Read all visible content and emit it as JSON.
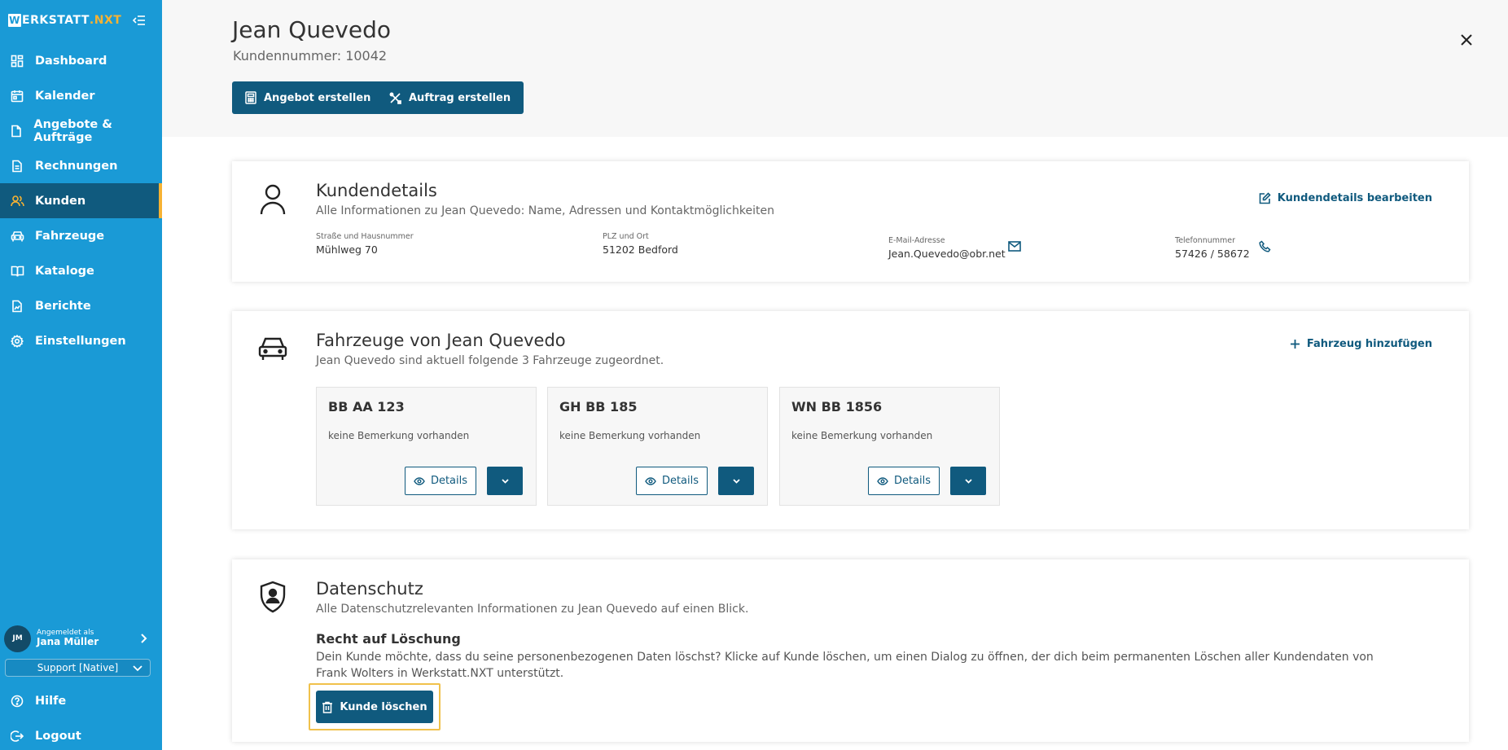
{
  "app": {
    "logo_w": "W",
    "logo_text": "ERKSTATT",
    "logo_suffix": ".NXT"
  },
  "sidebar": {
    "items": [
      {
        "label": "Dashboard",
        "icon": "dashboard-icon"
      },
      {
        "label": "Kalender",
        "icon": "calendar-icon"
      },
      {
        "label": "Angebote & Aufträge",
        "icon": "document-icon"
      },
      {
        "label": "Rechnungen",
        "icon": "invoice-icon"
      },
      {
        "label": "Kunden",
        "icon": "users-icon",
        "active": true
      },
      {
        "label": "Fahrzeuge",
        "icon": "car-icon"
      },
      {
        "label": "Kataloge",
        "icon": "book-icon"
      },
      {
        "label": "Berichte",
        "icon": "report-icon"
      },
      {
        "label": "Einstellungen",
        "icon": "gear-icon"
      }
    ],
    "user": {
      "initials": "JM",
      "logged_in_label": "Angemeldet als",
      "name": "Jana Müller"
    },
    "support_select": "Support [Native]",
    "help_label": "Hilfe",
    "logout_label": "Logout"
  },
  "header": {
    "customer_name": "Jean Quevedo",
    "customer_number": "Kundennummer: 10042",
    "btn_offer": "Angebot erstellen",
    "btn_order": "Auftrag erstellen"
  },
  "details": {
    "title": "Kundendetails",
    "subtitle": "Alle Informationen zu Jean Quevedo: Name, Adressen und Kontaktmöglichkeiten",
    "edit_label": "Kundendetails bearbeiten",
    "street_label": "Straße und Hausnummer",
    "street_value": "Mühlweg 70",
    "city_label": "PLZ und Ort",
    "city_value": "51202 Bedford",
    "email_label": "E-Mail-Adresse",
    "email_value": "Jean.Quevedo@obr.net",
    "phone_label": "Telefonnummer",
    "phone_value": "57426 / 58672"
  },
  "vehicles": {
    "title": "Fahrzeuge von Jean Quevedo",
    "subtitle": "Jean Quevedo sind aktuell folgende 3 Fahrzeuge zugeordnet.",
    "add_label": "Fahrzeug hinzufügen",
    "details_label": "Details",
    "items": [
      {
        "plate": "BB AA 123",
        "note": "keine Bemerkung vorhanden"
      },
      {
        "plate": "GH BB 185",
        "note": "keine Bemerkung vorhanden"
      },
      {
        "plate": "WN BB 1856",
        "note": "keine Bemerkung vorhanden"
      }
    ]
  },
  "privacy": {
    "title": "Datenschutz",
    "subtitle": "Alle Datenschutzrelevanten Informationen zu Jean Quevedo auf einen Blick.",
    "deletion_title": "Recht auf Löschung",
    "deletion_text": "Dein Kunde möchte, dass du seine personenbezogenen Daten löschst? Klicke auf Kunde löschen, um einen Dialog zu öffnen, der dich beim permanenten Löschen aller Kundendaten von Frank Wolters in Werkstatt.NXT unterstützt.",
    "delete_button": "Kunde löschen"
  },
  "colors": {
    "sidebar": "#1a9ad6",
    "primary": "#105a7e",
    "accent": "#f7b233",
    "highlight": "#f0c14b"
  }
}
